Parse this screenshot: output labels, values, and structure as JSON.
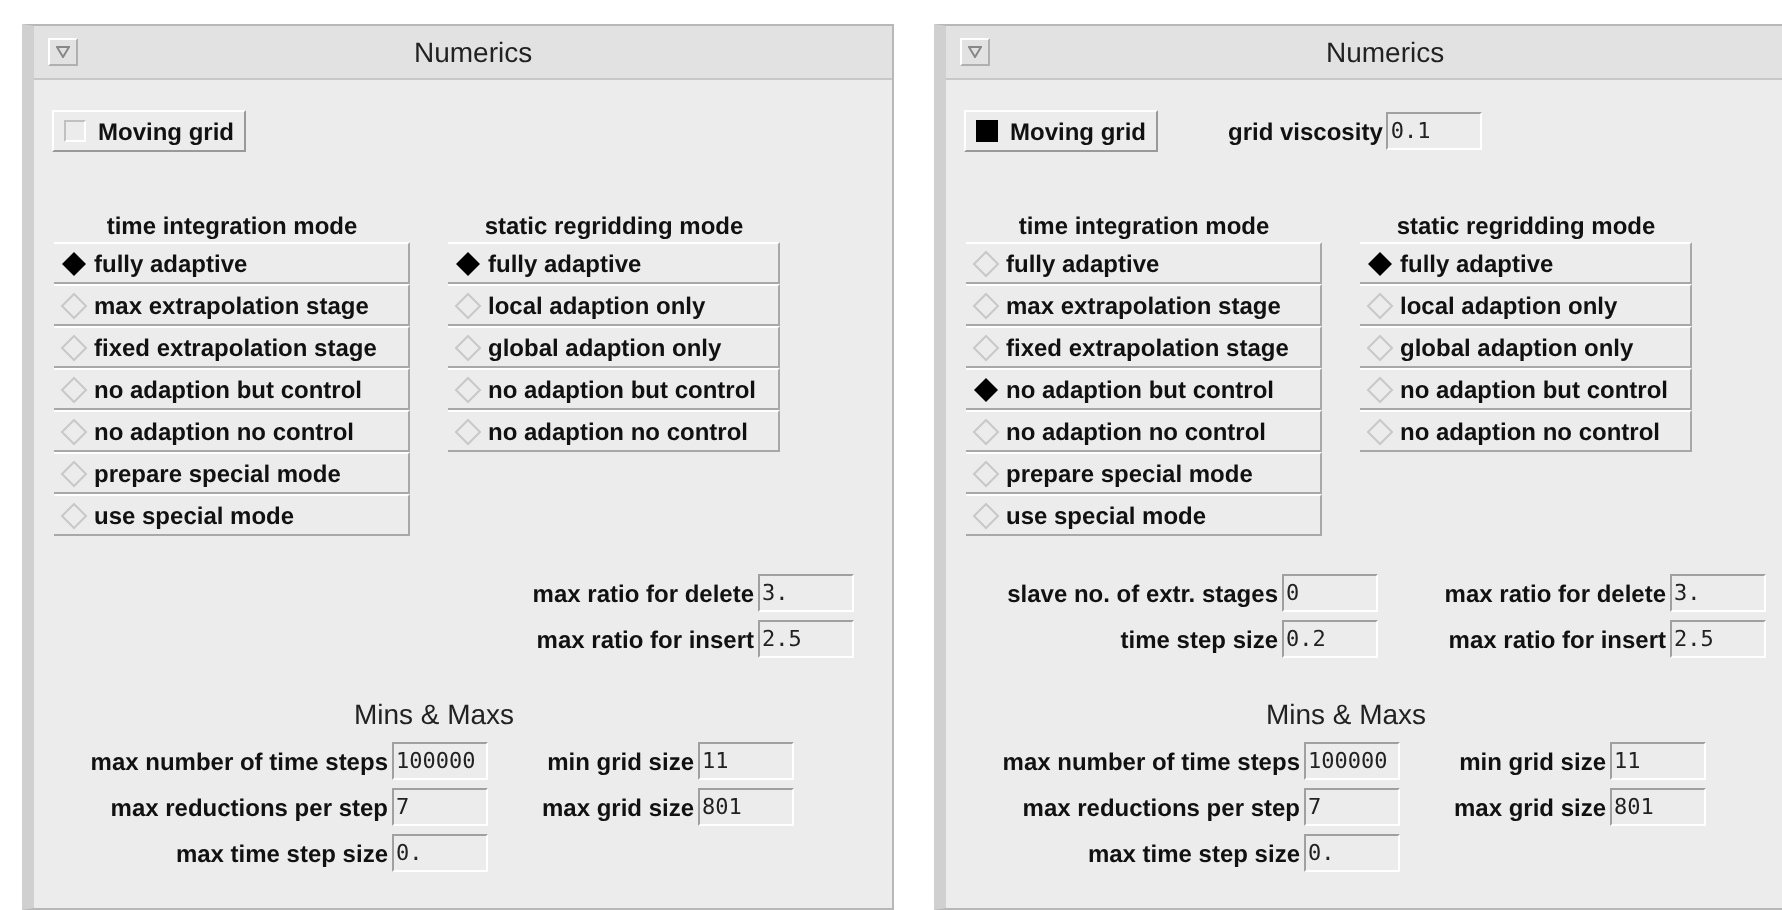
{
  "windows": [
    {
      "title": "Numerics",
      "moving_grid": {
        "label": "Moving grid",
        "checked": false
      },
      "time_integration_mode": {
        "heading": "time integration mode",
        "options": [
          {
            "label": "fully adaptive",
            "selected": true
          },
          {
            "label": "max extrapolation stage",
            "selected": false
          },
          {
            "label": "fixed extrapolation stage",
            "selected": false
          },
          {
            "label": "no adaption but control",
            "selected": false
          },
          {
            "label": "no adaption no control",
            "selected": false
          },
          {
            "label": "prepare special mode",
            "selected": false
          },
          {
            "label": "use special mode",
            "selected": false
          }
        ]
      },
      "static_regridding_mode": {
        "heading": "static regridding mode",
        "options": [
          {
            "label": "fully adaptive",
            "selected": true
          },
          {
            "label": "local adaption only",
            "selected": false
          },
          {
            "label": "global adaption only",
            "selected": false
          },
          {
            "label": "no adaption but control",
            "selected": false
          },
          {
            "label": "no adaption no control",
            "selected": false
          }
        ]
      },
      "ratio_fields": [
        {
          "label": "max ratio for delete",
          "value": "3."
        },
        {
          "label": "max ratio for insert",
          "value": "2.5"
        }
      ],
      "mins_maxs": {
        "heading": "Mins & Maxs",
        "left_fields": [
          {
            "label": "max number of time steps",
            "value": "100000"
          },
          {
            "label": "max reductions per step",
            "value": "7"
          },
          {
            "label": "max time step size",
            "value": "0."
          }
        ],
        "right_fields": [
          {
            "label": "min grid size",
            "value": "11"
          },
          {
            "label": "max grid size",
            "value": "801"
          }
        ]
      }
    },
    {
      "title": "Numerics",
      "moving_grid": {
        "label": "Moving grid",
        "checked": true
      },
      "grid_viscosity": {
        "label": "grid viscosity",
        "value": "0.1"
      },
      "time_integration_mode": {
        "heading": "time integration mode",
        "options": [
          {
            "label": "fully adaptive",
            "selected": false
          },
          {
            "label": "max extrapolation stage",
            "selected": false
          },
          {
            "label": "fixed extrapolation stage",
            "selected": false
          },
          {
            "label": "no adaption but control",
            "selected": true
          },
          {
            "label": "no adaption no control",
            "selected": false
          },
          {
            "label": "prepare special mode",
            "selected": false
          },
          {
            "label": "use special mode",
            "selected": false
          }
        ]
      },
      "static_regridding_mode": {
        "heading": "static regridding mode",
        "options": [
          {
            "label": "fully adaptive",
            "selected": true
          },
          {
            "label": "local adaption only",
            "selected": false
          },
          {
            "label": "global adaption only",
            "selected": false
          },
          {
            "label": "no adaption but control",
            "selected": false
          },
          {
            "label": "no adaption no control",
            "selected": false
          }
        ]
      },
      "slave_fields": [
        {
          "label": "slave no. of extr. stages",
          "value": "0"
        },
        {
          "label": "time step size",
          "value": "0.2"
        }
      ],
      "ratio_fields": [
        {
          "label": "max ratio for delete",
          "value": "3."
        },
        {
          "label": "max ratio for insert",
          "value": "2.5"
        }
      ],
      "mins_maxs": {
        "heading": "Mins & Maxs",
        "left_fields": [
          {
            "label": "max number of time steps",
            "value": "100000"
          },
          {
            "label": "max reductions per step",
            "value": "7"
          },
          {
            "label": "max time step size",
            "value": "0."
          }
        ],
        "right_fields": [
          {
            "label": "min grid size",
            "value": "11"
          },
          {
            "label": "max grid size",
            "value": "801"
          }
        ]
      }
    }
  ]
}
